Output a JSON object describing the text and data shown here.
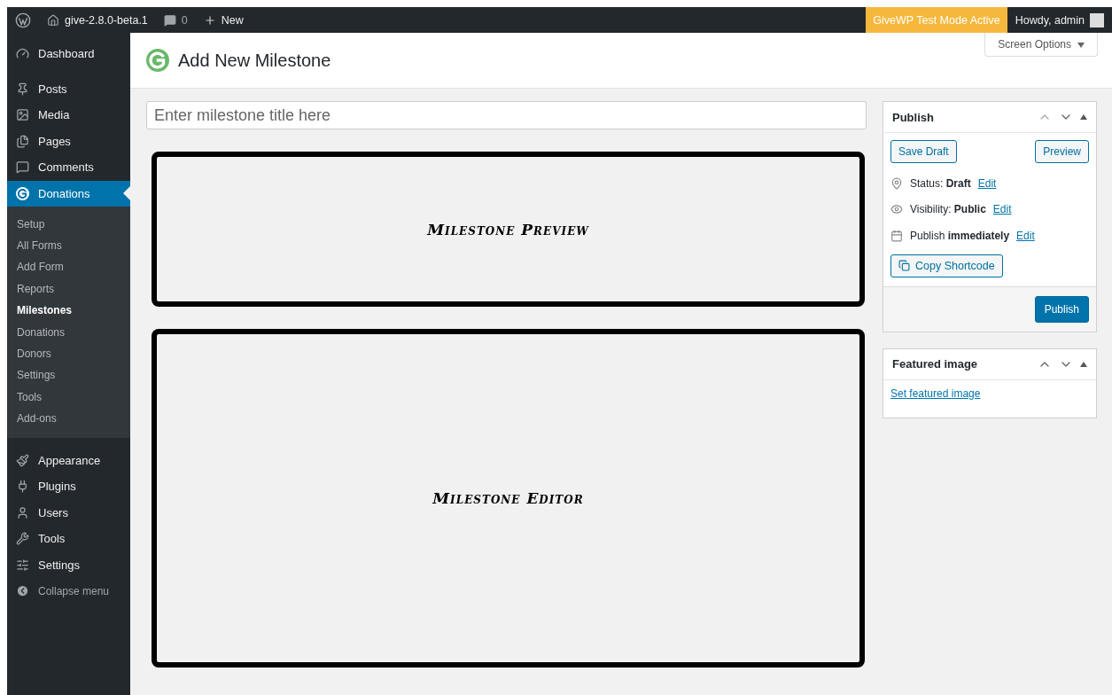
{
  "admin_bar": {
    "site": "give-2.8.0-beta.1",
    "comments": "0",
    "new": "New",
    "notice": "GiveWP Test Mode Active",
    "greeting": "Howdy, admin"
  },
  "sidebar": {
    "items": [
      {
        "label": "Dashboard",
        "selected": false
      },
      {
        "label": "Posts",
        "selected": false
      },
      {
        "label": "Media",
        "selected": false
      },
      {
        "label": "Pages",
        "selected": false
      },
      {
        "label": "Comments",
        "selected": false
      },
      {
        "label": "Donations",
        "selected": true,
        "children": [
          {
            "label": "Setup",
            "selected": false
          },
          {
            "label": "All Forms",
            "selected": false
          },
          {
            "label": "Add Form",
            "selected": false
          },
          {
            "label": "Reports",
            "selected": false
          },
          {
            "label": "Milestones",
            "selected": true
          },
          {
            "label": "Donations",
            "selected": false
          },
          {
            "label": "Donors",
            "selected": false
          },
          {
            "label": "Settings",
            "selected": false
          },
          {
            "label": "Tools",
            "selected": false
          },
          {
            "label": "Add-ons",
            "selected": false
          }
        ]
      },
      {
        "label": "Appearance",
        "selected": false
      },
      {
        "label": "Plugins",
        "selected": false
      },
      {
        "label": "Users",
        "selected": false
      },
      {
        "label": "Tools",
        "selected": false
      },
      {
        "label": "Settings",
        "selected": false
      }
    ],
    "collapse": "Collapse menu"
  },
  "screen_options": "Screen Options",
  "page_title": "Add New Milestone",
  "title_field": {
    "placeholder": "Enter milestone title here"
  },
  "panels": [
    {
      "label": "Milestone Preview",
      "kind": "short"
    },
    {
      "label": "Milestone Editor",
      "kind": "tall"
    }
  ],
  "publish_box": {
    "title": "Publish",
    "save_draft": "Save Draft",
    "preview": "Preview",
    "meta": [
      {
        "text": "Status: **Draft**",
        "link": "Edit"
      },
      {
        "text": "Visibility: **Public**",
        "link": "Edit"
      },
      {
        "text": "Publish **immediately**",
        "link": "Edit"
      }
    ],
    "copy_shortcode": "Copy Shortcode",
    "publish": "Publish"
  },
  "featured_box": {
    "title": "Featured image",
    "link": "Set featured image"
  }
}
